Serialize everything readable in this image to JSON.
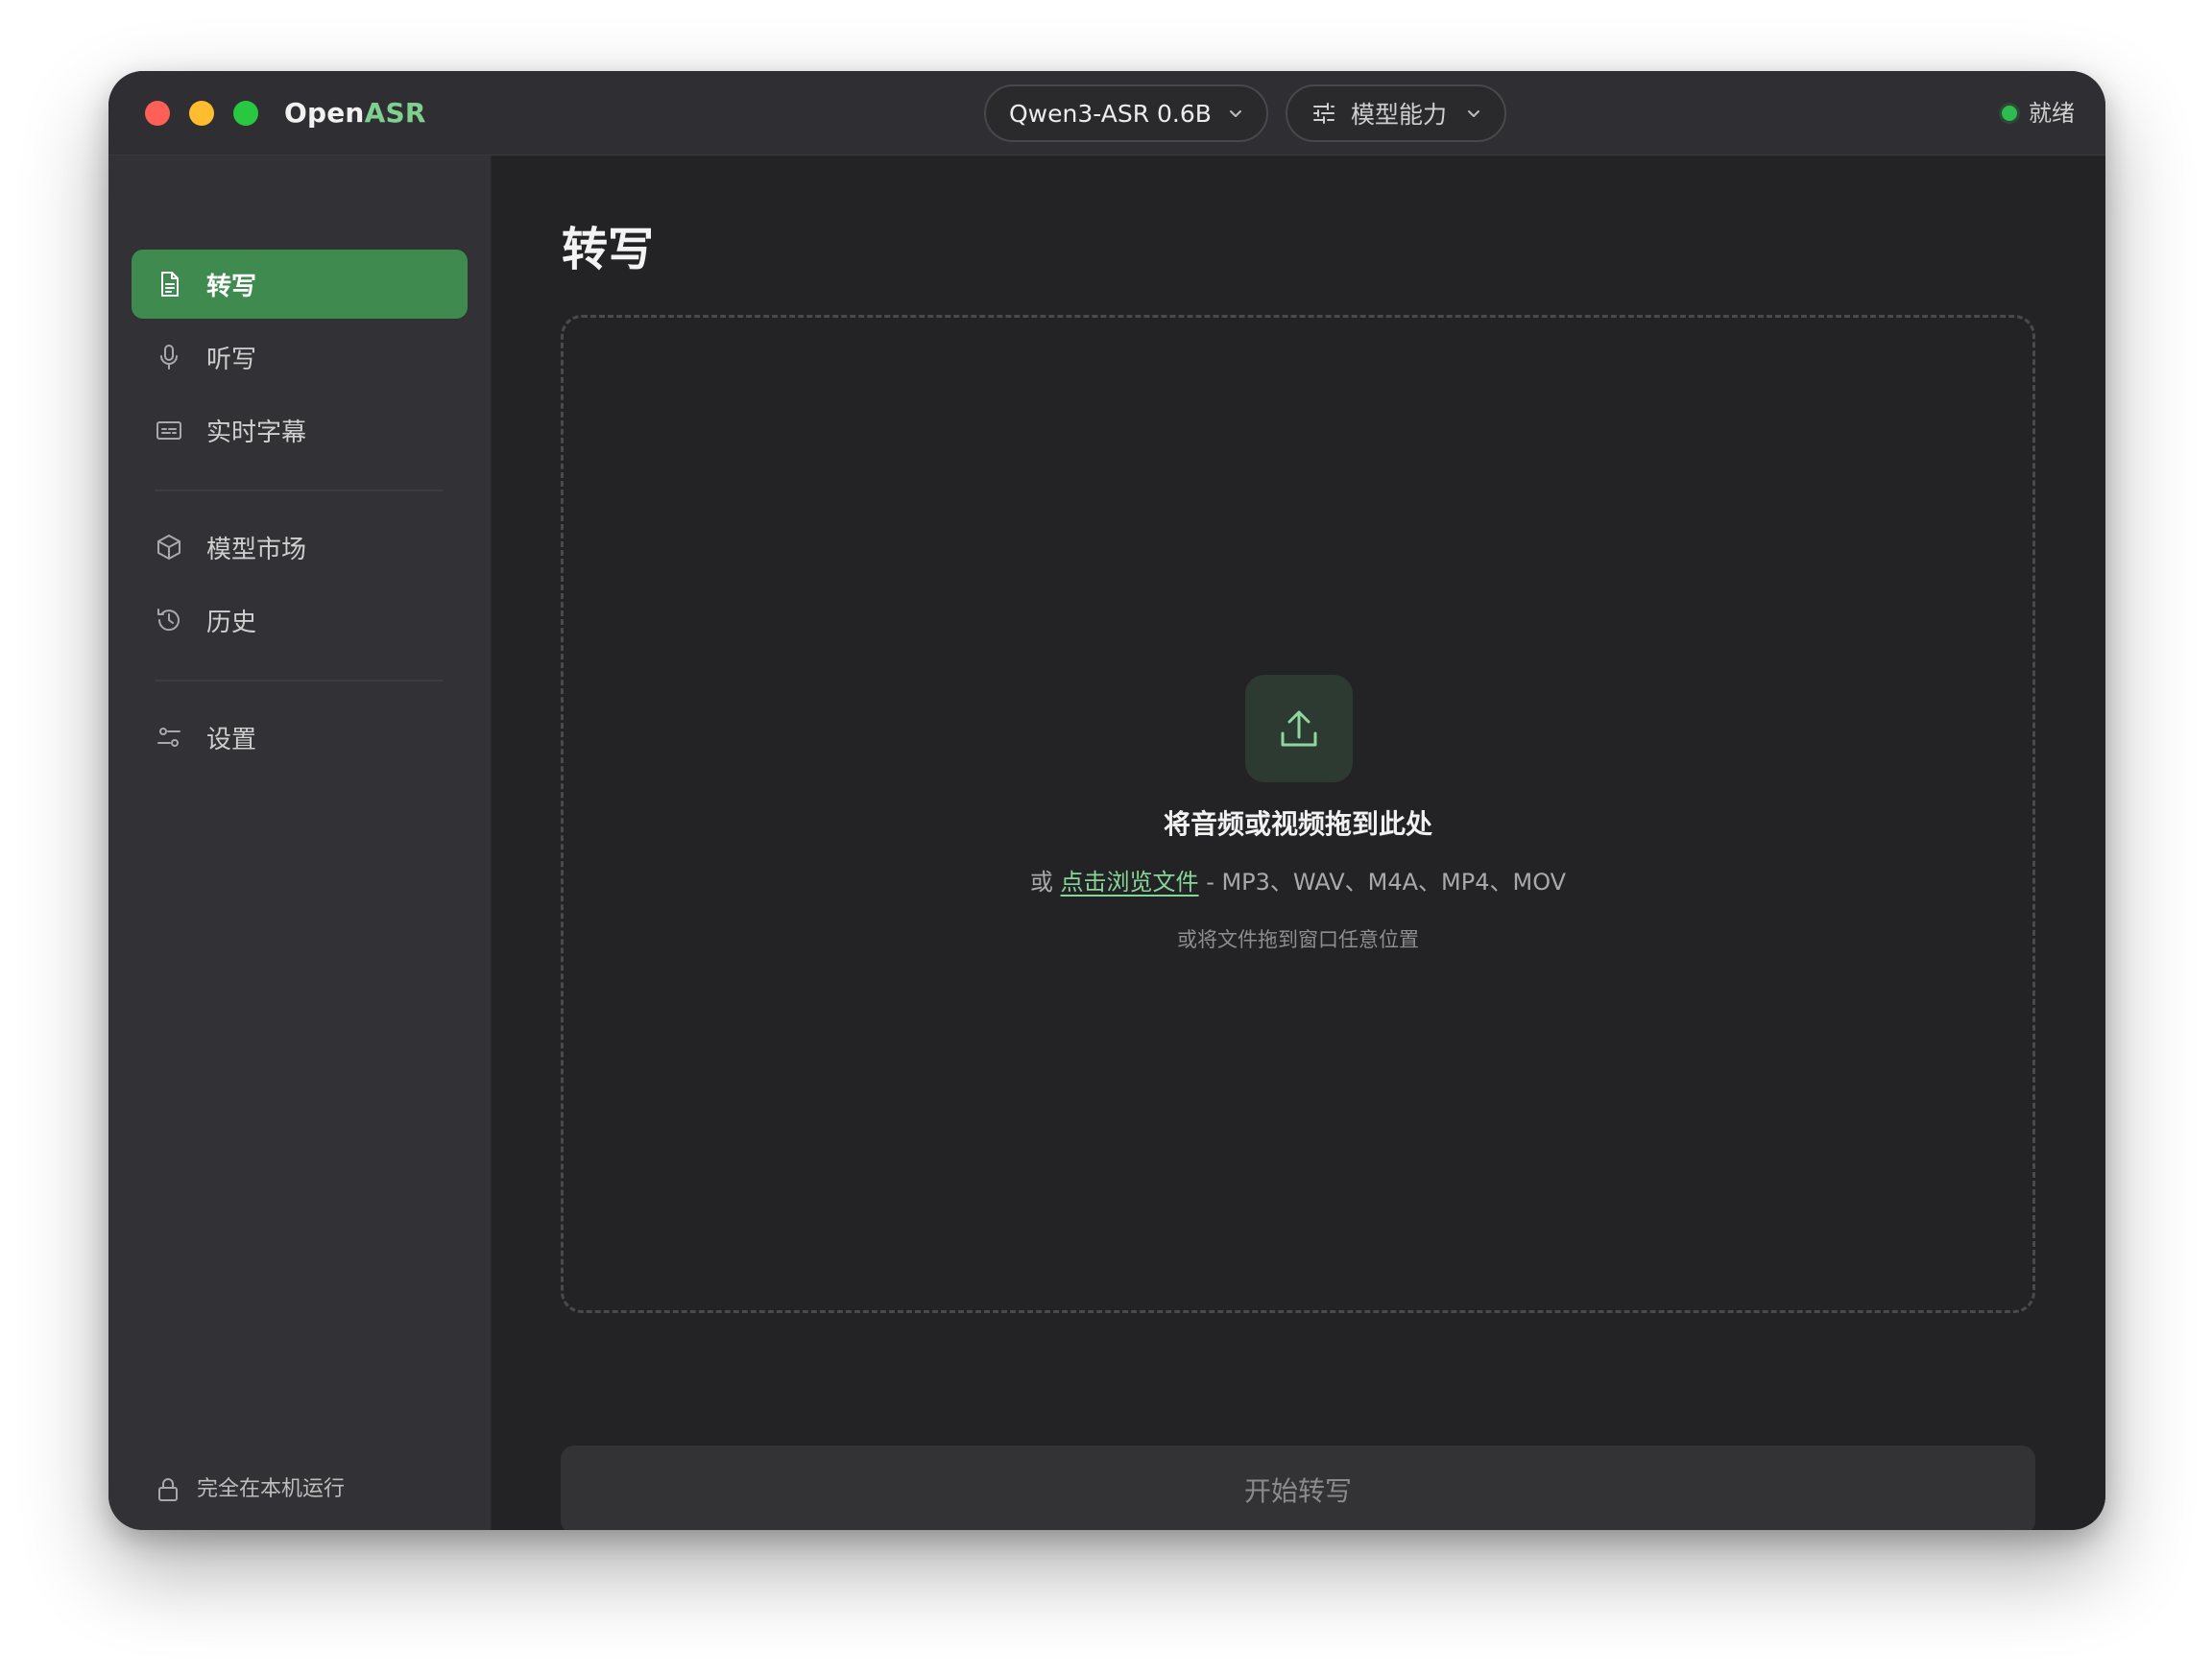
{
  "app": {
    "brand_main": "Open",
    "brand_accent": "ASR",
    "accent_color": "#3f8b4f",
    "link_color": "#86d69a",
    "status_color": "#2fbb4f"
  },
  "toolbar": {
    "model_select": {
      "value": "Qwen3-ASR 0.6B",
      "icon": "chevron-down-icon"
    },
    "capabilities": {
      "label": "模型能力",
      "icon": "sliders-icon"
    },
    "status": {
      "label": "就绪",
      "icon": "status-dot"
    }
  },
  "sidebar": {
    "items": [
      {
        "label": "转写",
        "icon": "document-icon",
        "active": true
      },
      {
        "label": "听写",
        "icon": "microphone-icon",
        "active": false
      },
      {
        "label": "实时字幕",
        "icon": "caption-icon",
        "active": false
      },
      {
        "label": "模型市场",
        "icon": "cube-icon",
        "active": false
      },
      {
        "label": "历史",
        "icon": "history-icon",
        "active": false
      },
      {
        "label": "设置",
        "icon": "settings-icon",
        "active": false
      }
    ],
    "footer": {
      "label": "完全在本机运行",
      "icon": "lock-icon"
    }
  },
  "main": {
    "title": "转写",
    "dropzone": {
      "icon": "upload-icon",
      "title": "将音频或视频拖到此处",
      "prefix": "或",
      "browse_link": "点击浏览文件",
      "formats": "- MP3、WAV、M4A、MP4、MOV",
      "hint": "或将文件拖到窗口任意位置"
    },
    "start_button": "开始转写"
  }
}
